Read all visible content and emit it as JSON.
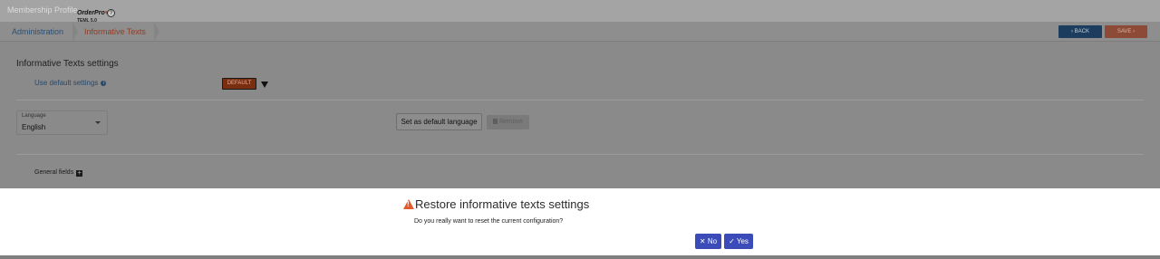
{
  "topbar": {
    "profile_label": "Membership Profile",
    "logo_name": "OrderPro",
    "logo_version": "TEML 5.0",
    "help_label": "?"
  },
  "breadcrumb": {
    "items": [
      "Administration",
      "Informative Texts"
    ]
  },
  "toolbar": {
    "back_label": "BACK",
    "save_label": "SAVE"
  },
  "settings": {
    "section_title": "Informative Texts settings",
    "use_default_label": "Use default settings",
    "default_badge": "DEFAULT",
    "language": {
      "label": "Language",
      "value": "English"
    },
    "set_default_language_label": "Set as default language",
    "remove_label": "Remove",
    "general_fields_label": "General fields"
  },
  "dialog": {
    "title": "Restore informative texts settings",
    "message": "Do you really want to reset the current configuration?",
    "no_label": "No",
    "yes_label": "Yes"
  },
  "colors": {
    "primary": "#3b4cb8",
    "warning": "#e35b2d",
    "default_badge": "#e0532a"
  }
}
